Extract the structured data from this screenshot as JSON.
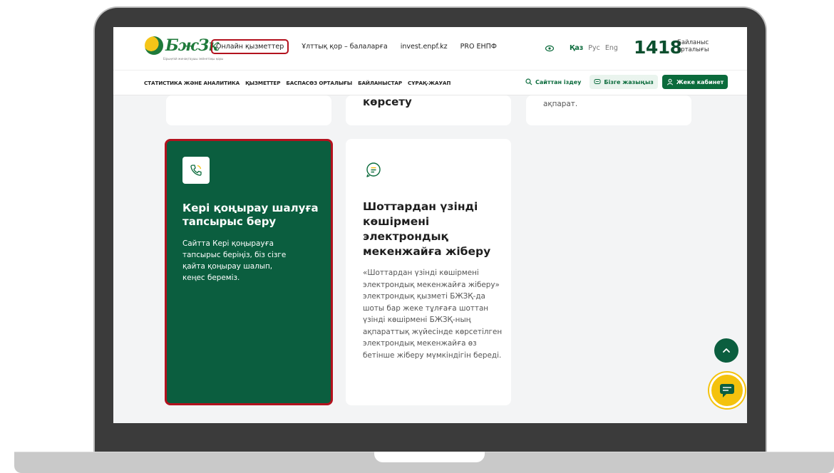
{
  "header": {
    "logo_text": "БжЗк",
    "logo_subtitle": "Бірыңғай жинақтаушы зейнетақы қоры",
    "nav": [
      "Онлайн қызметтер",
      "Ұлттық қор – балаларға",
      "invest.enpf.kz",
      "PRO ЕНПФ"
    ],
    "languages": [
      "Қаз",
      "Рус",
      "Eng"
    ],
    "active_language": "Қаз",
    "phone_number": "1418",
    "phone_label_line1": "Байланыс",
    "phone_label_line2": "орталығы"
  },
  "subheader": {
    "nav": [
      "СТАТИСТИКА ЖӘНЕ АНАЛИТИКА",
      "ҚЫЗМЕТТЕР",
      "БАСПАСӨЗ ОРТАЛЫҒЫ",
      "БАЙЛАНЫСТАР",
      "СҰРАҚ-ЖАУАП"
    ],
    "search_label": "Сайттан іздеу",
    "write_label": "Бізге жазыңыз",
    "cabinet_label": "Жеке кабинет"
  },
  "cards_top": {
    "middle_partial_title": "көрсету",
    "right_partial_text": "ақпарат."
  },
  "card_callback": {
    "title": "Кері қоңырау шалуға тапсырыс беру",
    "description": "Сайтта Кері қоңырауға тапсырыс беріңіз, біз сізге қайта қоңырау шалып, кеңес береміз."
  },
  "card_statement": {
    "title": "Шоттардан үзінді көшірмені электрондық мекенжайға жіберу",
    "description": "«Шоттардан үзінді көшірмені электрондық мекенжайға жіберу» электрондық қызметі БЖЗҚ-да шоты бар жеке тұлғаға шоттан үзінді көшірмені БЖЗҚ-ның ақпараттық жүйесінде көрсетілген электрондық мекенжайға өз бетінше жіберу мүмкіндігін береді."
  },
  "colors": {
    "brand_green": "#0b5e3f",
    "highlight_red": "#b3121e",
    "accent_yellow": "#f4c20d"
  }
}
